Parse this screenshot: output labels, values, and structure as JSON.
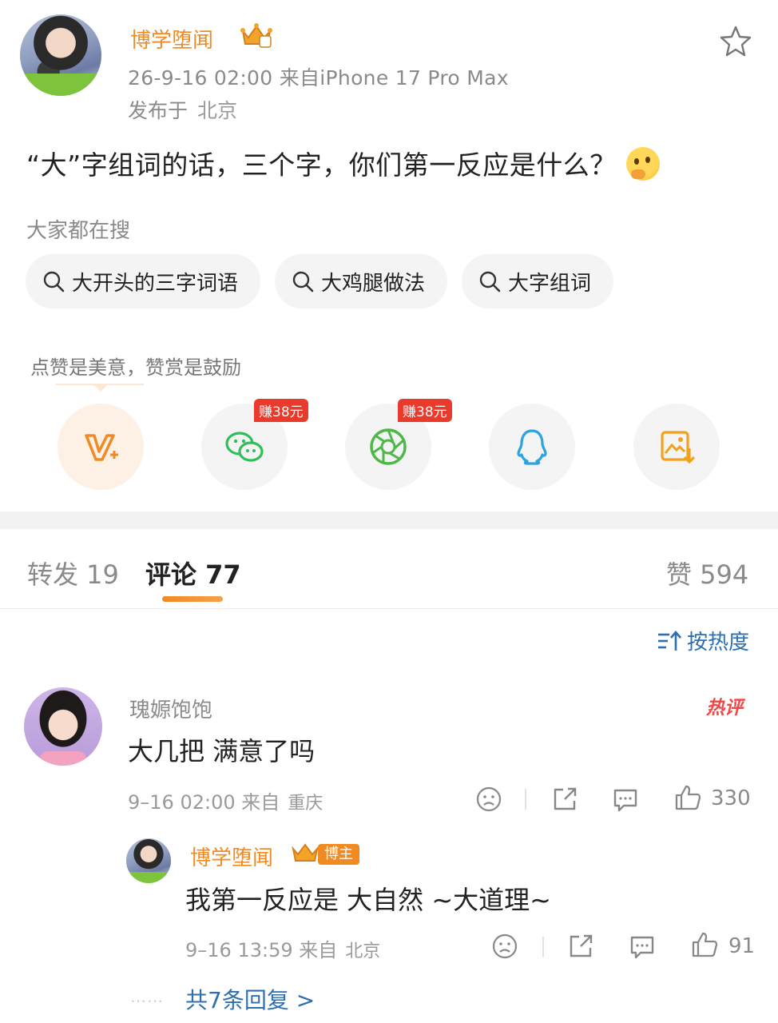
{
  "post": {
    "author": "博学堕闻",
    "time_source": "26-9-16 02:00  来自iPhone 17 Pro Max",
    "published_label": "发布于",
    "published_location": "北京",
    "text": "“大”字组词的话，三个字，你们第一反应是什么？"
  },
  "search": {
    "title": "大家都在搜",
    "chips": [
      "大开头的三字词语",
      "大鸡腿做法",
      "大字组词"
    ]
  },
  "reward": {
    "text": "点赞是美意，赞赏是鼓励",
    "badge_wechat": "赚38元",
    "badge_moments": "赚38元"
  },
  "tabs": {
    "repost": "转发 19",
    "comment": "评论 77",
    "like": "赞 594"
  },
  "sort_label": "按热度",
  "comment": {
    "user": "瑰嫄饱饱",
    "hot_label": "热评",
    "text": "大几把 满意了吗",
    "time": "9–16 02:00  来自",
    "location": "重庆",
    "likes": "330"
  },
  "reply": {
    "user": "博学堕闻",
    "badge": "博主",
    "text": "我第一反应是 大自然 ~大道理~",
    "time": "9–16 13:59  来自",
    "location": "北京",
    "likes": "91"
  },
  "more_replies": "共7条回复 >",
  "colors": {
    "accent": "#f08a24",
    "link": "#2d6fb1",
    "hot": "#f04848"
  }
}
